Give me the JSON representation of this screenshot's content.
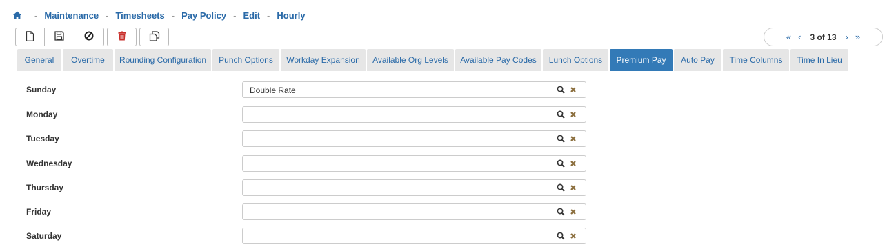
{
  "breadcrumb": {
    "home_icon": "home-icon",
    "separator": "-",
    "items": [
      "Maintenance",
      "Timesheets",
      "Pay Policy",
      "Edit",
      "Hourly"
    ]
  },
  "toolbar": {
    "buttons": [
      "new-document-icon",
      "save-icon",
      "cancel-icon",
      "delete-icon",
      "copy-icon"
    ]
  },
  "pager": {
    "first": "«",
    "prev": "‹",
    "text": "3 of 13",
    "next": "›",
    "last": "»"
  },
  "tabs": [
    {
      "label": "General",
      "active": false
    },
    {
      "label": "Overtime",
      "active": false
    },
    {
      "label": "Rounding Configuration",
      "active": false
    },
    {
      "label": "Punch Options",
      "active": false
    },
    {
      "label": "Workday Expansion",
      "active": false
    },
    {
      "label": "Available Org Levels",
      "active": false
    },
    {
      "label": "Available Pay Codes",
      "active": false
    },
    {
      "label": "Lunch Options",
      "active": false
    },
    {
      "label": "Premium Pay",
      "active": true
    },
    {
      "label": "Auto Pay",
      "active": false
    },
    {
      "label": "Time Columns",
      "active": false
    },
    {
      "label": "Time In Lieu",
      "active": false
    }
  ],
  "days": [
    {
      "label": "Sunday",
      "value": "Double Rate"
    },
    {
      "label": "Monday",
      "value": ""
    },
    {
      "label": "Tuesday",
      "value": ""
    },
    {
      "label": "Wednesday",
      "value": ""
    },
    {
      "label": "Thursday",
      "value": ""
    },
    {
      "label": "Friday",
      "value": ""
    },
    {
      "label": "Saturday",
      "value": ""
    }
  ],
  "colors": {
    "accent": "#337ab7",
    "link": "#2a6aa8",
    "delete": "#c9302c",
    "clear": "#8a6d3b"
  }
}
